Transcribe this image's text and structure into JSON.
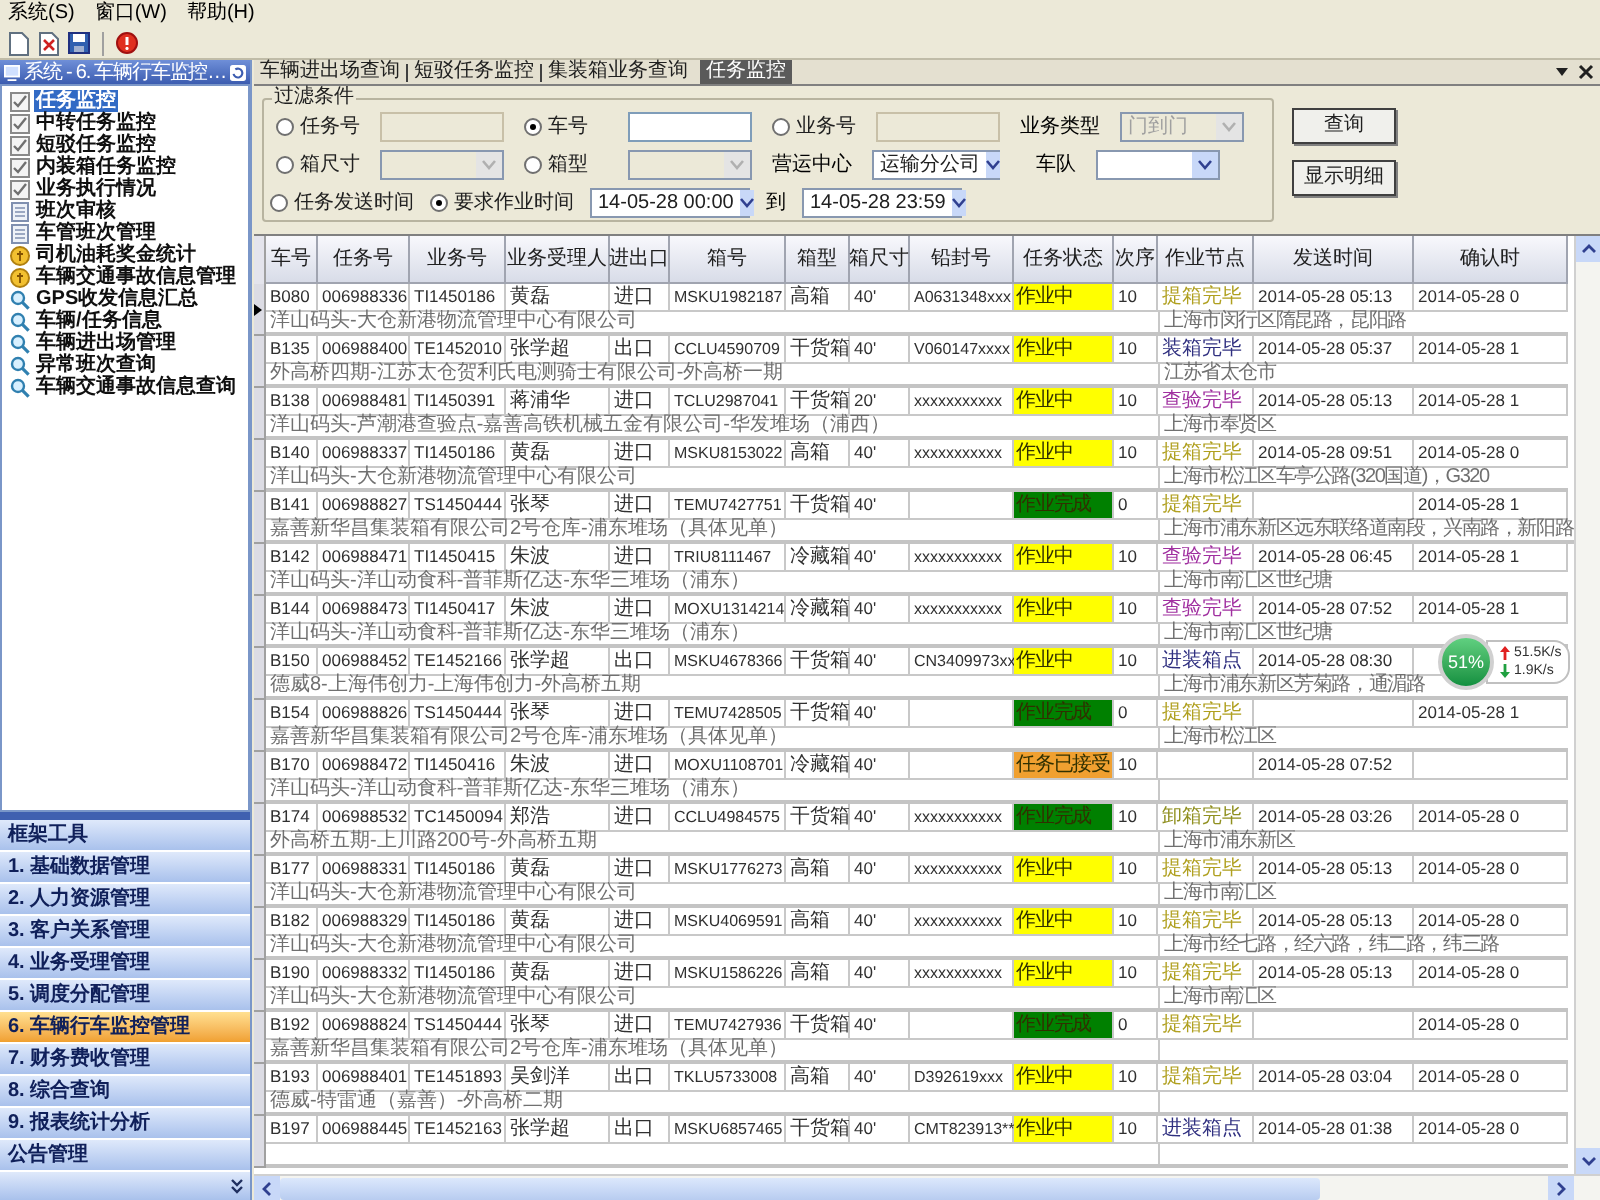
{
  "menu": [
    "系统(S)",
    "窗口(W)",
    "帮助(H)"
  ],
  "sidebar": {
    "title": "系统 - 6. 车辆行车监控…",
    "tree": [
      {
        "label": "任务监控",
        "kind": "check",
        "selected": true
      },
      {
        "label": "中转任务监控",
        "kind": "check",
        "selected": false
      },
      {
        "label": "短驳任务监控",
        "kind": "check",
        "selected": false
      },
      {
        "label": "内装箱任务监控",
        "kind": "check",
        "selected": false
      },
      {
        "label": "业务执行情况",
        "kind": "check",
        "selected": false
      },
      {
        "label": "班次审核",
        "kind": "doc",
        "selected": false
      },
      {
        "label": "车管班次管理",
        "kind": "doc",
        "selected": false
      },
      {
        "label": "司机油耗奖金统计",
        "kind": "coin",
        "selected": false
      },
      {
        "label": "车辆交通事故信息管理",
        "kind": "coin",
        "selected": false
      },
      {
        "label": "GPS收发信息汇总",
        "kind": "query",
        "selected": false
      },
      {
        "label": "车辆/任务信息",
        "kind": "query",
        "selected": false
      },
      {
        "label": "车辆进出场管理",
        "kind": "query",
        "selected": false
      },
      {
        "label": "异常班次查询",
        "kind": "query",
        "selected": false
      },
      {
        "label": "车辆交通事故信息查询",
        "kind": "query",
        "selected": false
      }
    ],
    "nav": [
      {
        "label": "框架工具",
        "selected": false
      },
      {
        "label": "1. 基础数据管理",
        "selected": false
      },
      {
        "label": "2. 人力资源管理",
        "selected": false
      },
      {
        "label": "3. 客户关系管理",
        "selected": false
      },
      {
        "label": "4. 业务受理管理",
        "selected": false
      },
      {
        "label": "5. 调度分配管理",
        "selected": false
      },
      {
        "label": "6. 车辆行车监控管理",
        "selected": true
      },
      {
        "label": "7. 财务费收管理",
        "selected": false
      },
      {
        "label": "8. 综合查询",
        "selected": false
      },
      {
        "label": "9. 报表统计分析",
        "selected": false
      },
      {
        "label": "公告管理",
        "selected": false
      }
    ]
  },
  "tabs": [
    {
      "label": "车辆进出场查询",
      "selected": false
    },
    {
      "label": "短驳任务监控",
      "selected": false
    },
    {
      "label": "集装箱业务查询",
      "selected": false
    },
    {
      "label": "任务监控",
      "selected": true
    }
  ],
  "filter": {
    "title": "过滤条件",
    "criteria": [
      {
        "label": "任务号",
        "kind": "text",
        "selected": false
      },
      {
        "label": "车号",
        "kind": "text",
        "selected": true
      },
      {
        "label": "业务号",
        "kind": "text",
        "selected": false
      },
      {
        "label": "箱尺寸",
        "kind": "select",
        "selected": false
      },
      {
        "label": "箱型",
        "kind": "select",
        "selected": false
      }
    ],
    "business_type": {
      "label": "业务类型",
      "value": "门到门",
      "disabled": true
    },
    "ops_center": {
      "label": "营运中心",
      "value": "运输分公司"
    },
    "fleet": {
      "label": "车队"
    },
    "time_mode": [
      {
        "label": "任务发送时间",
        "selected": false
      },
      {
        "label": "要求作业时间",
        "selected": true
      }
    ],
    "from": "14-05-28 00:00",
    "to_label": "到",
    "to": "14-05-28 23:59",
    "buttons": [
      "查询",
      "显示明细"
    ]
  },
  "table": {
    "columns": [
      "车号",
      "任务号",
      "业务号",
      "业务受理人",
      "进出口",
      "箱号",
      "箱型",
      "箱尺寸",
      "铅封号",
      "任务状态",
      "次序",
      "作业节点",
      "发送时间",
      "确认时"
    ],
    "rows": [
      {
        "current": true,
        "plate": "B080",
        "task_no": "006988336",
        "biz_no": "TI1450186",
        "handler": "黄磊",
        "direction": "进口",
        "container_no": "MSKU1982187",
        "container_type": "高箱",
        "size": "40'",
        "seal_no": "A0631348xxx",
        "status": {
          "label": "作业中",
          "color": "#ffff00"
        },
        "seq": "10",
        "node": {
          "label": "提箱完毕",
          "color": "#b0a020"
        },
        "sent": "2014-05-28 05:13",
        "confirmed": "2014-05-28 0",
        "route": "洋山码头-大仓新港物流管理中心有限公司",
        "location": "上海市闵行区隋昆路，昆阳路"
      },
      {
        "current": false,
        "plate": "B135",
        "task_no": "006988400",
        "biz_no": "TE1452010",
        "handler": "张学超",
        "direction": "出口",
        "container_no": "CCLU4590709",
        "container_type": "干货箱",
        "size": "40'",
        "seal_no": "V060147xxxx",
        "status": {
          "label": "作业中",
          "color": "#ffff00"
        },
        "seq": "10",
        "node": {
          "label": "装箱完毕",
          "color": "#303080"
        },
        "sent": "2014-05-28 05:37",
        "confirmed": "2014-05-28 1",
        "route": "外高桥四期-江苏太仓贺利氏电测骑士有限公司-外高桥一期",
        "location": "江苏省太仓市"
      },
      {
        "current": false,
        "plate": "B138",
        "task_no": "006988481",
        "biz_no": "TI1450391",
        "handler": "蒋浦华",
        "direction": "进口",
        "container_no": "TCLU2987041",
        "container_type": "干货箱",
        "size": "20'",
        "seal_no": "xxxxxxxxxxx",
        "status": {
          "label": "作业中",
          "color": "#ffff00"
        },
        "seq": "10",
        "node": {
          "label": "查验完毕",
          "color": "#a030a0"
        },
        "sent": "2014-05-28 05:13",
        "confirmed": "2014-05-28 1",
        "route": "洋山码头-芦潮港查验点-嘉善高铁机械五金有限公司-华发堆场（浦西）",
        "location": "上海市奉贤区"
      },
      {
        "current": false,
        "plate": "B140",
        "task_no": "006988337",
        "biz_no": "TI1450186",
        "handler": "黄磊",
        "direction": "进口",
        "container_no": "MSKU8153022",
        "container_type": "高箱",
        "size": "40'",
        "seal_no": "xxxxxxxxxxx",
        "status": {
          "label": "作业中",
          "color": "#ffff00"
        },
        "seq": "10",
        "node": {
          "label": "提箱完毕",
          "color": "#b0a020"
        },
        "sent": "2014-05-28 09:51",
        "confirmed": "2014-05-28 0",
        "route": "洋山码头-大仓新港物流管理中心有限公司",
        "location": "上海市松江区车亭公路(320国道)，G320"
      },
      {
        "current": false,
        "plate": "B141",
        "task_no": "006988827",
        "biz_no": "TS1450444",
        "handler": "张琴",
        "direction": "进口",
        "container_no": "TEMU7427751",
        "container_type": "干货箱",
        "size": "40'",
        "status": {
          "label": "作业完成",
          "color": "#008000"
        },
        "seq": "0",
        "node": {
          "label": "提箱完毕",
          "color": "#b0a020"
        },
        "confirmed": "2014-05-28 1",
        "route": "嘉善新华昌集装箱有限公司2号仓库-浦东堆场（具体见单）",
        "location": "上海市浦东新区远东联络道南段，兴南路，新阳路"
      },
      {
        "current": false,
        "plate": "B142",
        "task_no": "006988471",
        "biz_no": "TI1450415",
        "handler": "朱波",
        "direction": "进口",
        "container_no": "TRIU8111467",
        "container_type": "冷藏箱",
        "size": "40'",
        "seal_no": "xxxxxxxxxxx",
        "status": {
          "label": "作业中",
          "color": "#ffff00"
        },
        "seq": "10",
        "node": {
          "label": "查验完毕",
          "color": "#a030a0"
        },
        "sent": "2014-05-28 06:45",
        "confirmed": "2014-05-28 1",
        "route": "洋山码头-洋山动食科-普菲斯亿达-东华三堆场（浦东）",
        "location": "上海市南汇区世纪塘"
      },
      {
        "current": false,
        "plate": "B144",
        "task_no": "006988473",
        "biz_no": "TI1450417",
        "handler": "朱波",
        "direction": "进口",
        "container_no": "MOXU1314214",
        "container_type": "冷藏箱",
        "size": "40'",
        "seal_no": "xxxxxxxxxxx",
        "status": {
          "label": "作业中",
          "color": "#ffff00"
        },
        "seq": "10",
        "node": {
          "label": "查验完毕",
          "color": "#a030a0"
        },
        "sent": "2014-05-28 07:52",
        "confirmed": "2014-05-28 1",
        "route": "洋山码头-洋山动食科-普菲斯亿达-东华三堆场（浦东）",
        "location": "上海市南汇区世纪塘"
      },
      {
        "current": false,
        "plate": "B150",
        "task_no": "006988452",
        "biz_no": "TE1452166",
        "handler": "张学超",
        "direction": "出口",
        "container_no": "MSKU4678366",
        "container_type": "干货箱",
        "size": "40'",
        "seal_no": "CN3409973xx",
        "status": {
          "label": "作业中",
          "color": "#ffff00"
        },
        "seq": "10",
        "node": {
          "label": "进装箱点",
          "color": "#303080"
        },
        "sent": "2014-05-28 08:30",
        "route": "德威8-上海伟创力-上海伟创力-外高桥五期",
        "location": "上海市浦东新区芳菊路，通湄路"
      },
      {
        "current": false,
        "plate": "B154",
        "task_no": "006988826",
        "biz_no": "TS1450444",
        "handler": "张琴",
        "direction": "进口",
        "container_no": "TEMU7428505",
        "container_type": "干货箱",
        "size": "40'",
        "status": {
          "label": "作业完成",
          "color": "#008000"
        },
        "seq": "0",
        "node": {
          "label": "提箱完毕",
          "color": "#b0a020"
        },
        "confirmed": "2014-05-28 1",
        "route": "嘉善新华昌集装箱有限公司2号仓库-浦东堆场（具体见单）",
        "location": "上海市松江区"
      },
      {
        "current": false,
        "plate": "B170",
        "task_no": "006988472",
        "biz_no": "TI1450416",
        "handler": "朱波",
        "direction": "进口",
        "container_no": "MOXU1108701",
        "container_type": "冷藏箱",
        "size": "40'",
        "status": {
          "label": "任务已接受",
          "color": "#f0a030"
        },
        "seq": "10",
        "sent": "2014-05-28 07:52",
        "route": "洋山码头-洋山动食科-普菲斯亿达-东华三堆场（浦东）"
      },
      {
        "current": false,
        "plate": "B174",
        "task_no": "006988532",
        "biz_no": "TC1450094",
        "handler": "郑浩",
        "direction": "进口",
        "container_no": "CCLU4984575",
        "container_type": "干货箱",
        "size": "40'",
        "seal_no": "xxxxxxxxxxx",
        "status": {
          "label": "作业完成",
          "color": "#008000"
        },
        "seq": "10",
        "node": {
          "label": "卸箱完毕",
          "color": "#909020"
        },
        "sent": "2014-05-28 03:26",
        "confirmed": "2014-05-28 0",
        "route": "外高桥五期-上川路200号-外高桥五期",
        "location": "上海市浦东新区"
      },
      {
        "current": false,
        "plate": "B177",
        "task_no": "006988331",
        "biz_no": "TI1450186",
        "handler": "黄磊",
        "direction": "进口",
        "container_no": "MSKU1776273",
        "container_type": "高箱",
        "size": "40'",
        "seal_no": "xxxxxxxxxxx",
        "status": {
          "label": "作业中",
          "color": "#ffff00"
        },
        "seq": "10",
        "node": {
          "label": "提箱完毕",
          "color": "#b0a020"
        },
        "sent": "2014-05-28 05:13",
        "confirmed": "2014-05-28 0",
        "route": "洋山码头-大仓新港物流管理中心有限公司",
        "location": "上海市南汇区"
      },
      {
        "current": false,
        "plate": "B182",
        "task_no": "006988329",
        "biz_no": "TI1450186",
        "handler": "黄磊",
        "direction": "进口",
        "container_no": "MSKU4069591",
        "container_type": "高箱",
        "size": "40'",
        "seal_no": "xxxxxxxxxxx",
        "status": {
          "label": "作业中",
          "color": "#ffff00"
        },
        "seq": "10",
        "node": {
          "label": "提箱完毕",
          "color": "#b0a020"
        },
        "sent": "2014-05-28 05:13",
        "confirmed": "2014-05-28 0",
        "route": "洋山码头-大仓新港物流管理中心有限公司",
        "location": "上海市经七路，经六路，纬二路，纬三路"
      },
      {
        "current": false,
        "plate": "B190",
        "task_no": "006988332",
        "biz_no": "TI1450186",
        "handler": "黄磊",
        "direction": "进口",
        "container_no": "MSKU1586226",
        "container_type": "高箱",
        "size": "40'",
        "seal_no": "xxxxxxxxxxx",
        "status": {
          "label": "作业中",
          "color": "#ffff00"
        },
        "seq": "10",
        "node": {
          "label": "提箱完毕",
          "color": "#b0a020"
        },
        "sent": "2014-05-28 05:13",
        "confirmed": "2014-05-28 0",
        "route": "洋山码头-大仓新港物流管理中心有限公司",
        "location": "上海市南汇区"
      },
      {
        "current": false,
        "plate": "B192",
        "task_no": "006988824",
        "biz_no": "TS1450444",
        "handler": "张琴",
        "direction": "进口",
        "container_no": "TEMU7427936",
        "container_type": "干货箱",
        "size": "40'",
        "status": {
          "label": "作业完成",
          "color": "#008000"
        },
        "seq": "0",
        "node": {
          "label": "提箱完毕",
          "color": "#b0a020"
        },
        "confirmed": "2014-05-28 0",
        "route": "嘉善新华昌集装箱有限公司2号仓库-浦东堆场（具体见单）"
      },
      {
        "current": false,
        "plate": "B193",
        "task_no": "006988401",
        "biz_no": "TE1451893",
        "handler": "吴剑洋",
        "direction": "出口",
        "container_no": "TKLU5733008",
        "container_type": "高箱",
        "size": "40'",
        "seal_no": "D392619xxx",
        "status": {
          "label": "作业中",
          "color": "#ffff00"
        },
        "seq": "10",
        "node": {
          "label": "提箱完毕",
          "color": "#b0a020"
        },
        "sent": "2014-05-28 03:04",
        "confirmed": "2014-05-28 0",
        "route": "德威-特雷通（嘉善）-外高桥二期"
      },
      {
        "current": false,
        "plate": "B197",
        "task_no": "006988445",
        "biz_no": "TE1452163",
        "handler": "张学超",
        "direction": "出口",
        "container_no": "MSKU6857465",
        "container_type": "干货箱",
        "size": "40'",
        "seal_no": "CMT823913**",
        "status": {
          "label": "作业中",
          "color": "#ffff00"
        },
        "seq": "10",
        "node": {
          "label": "进装箱点",
          "color": "#303080"
        },
        "sent": "2014-05-28 01:38",
        "confirmed": "2014-05-28 0"
      }
    ]
  },
  "network_monitor": {
    "percent": "51%",
    "upload": "51.5K/s",
    "download": "1.9K/s"
  }
}
